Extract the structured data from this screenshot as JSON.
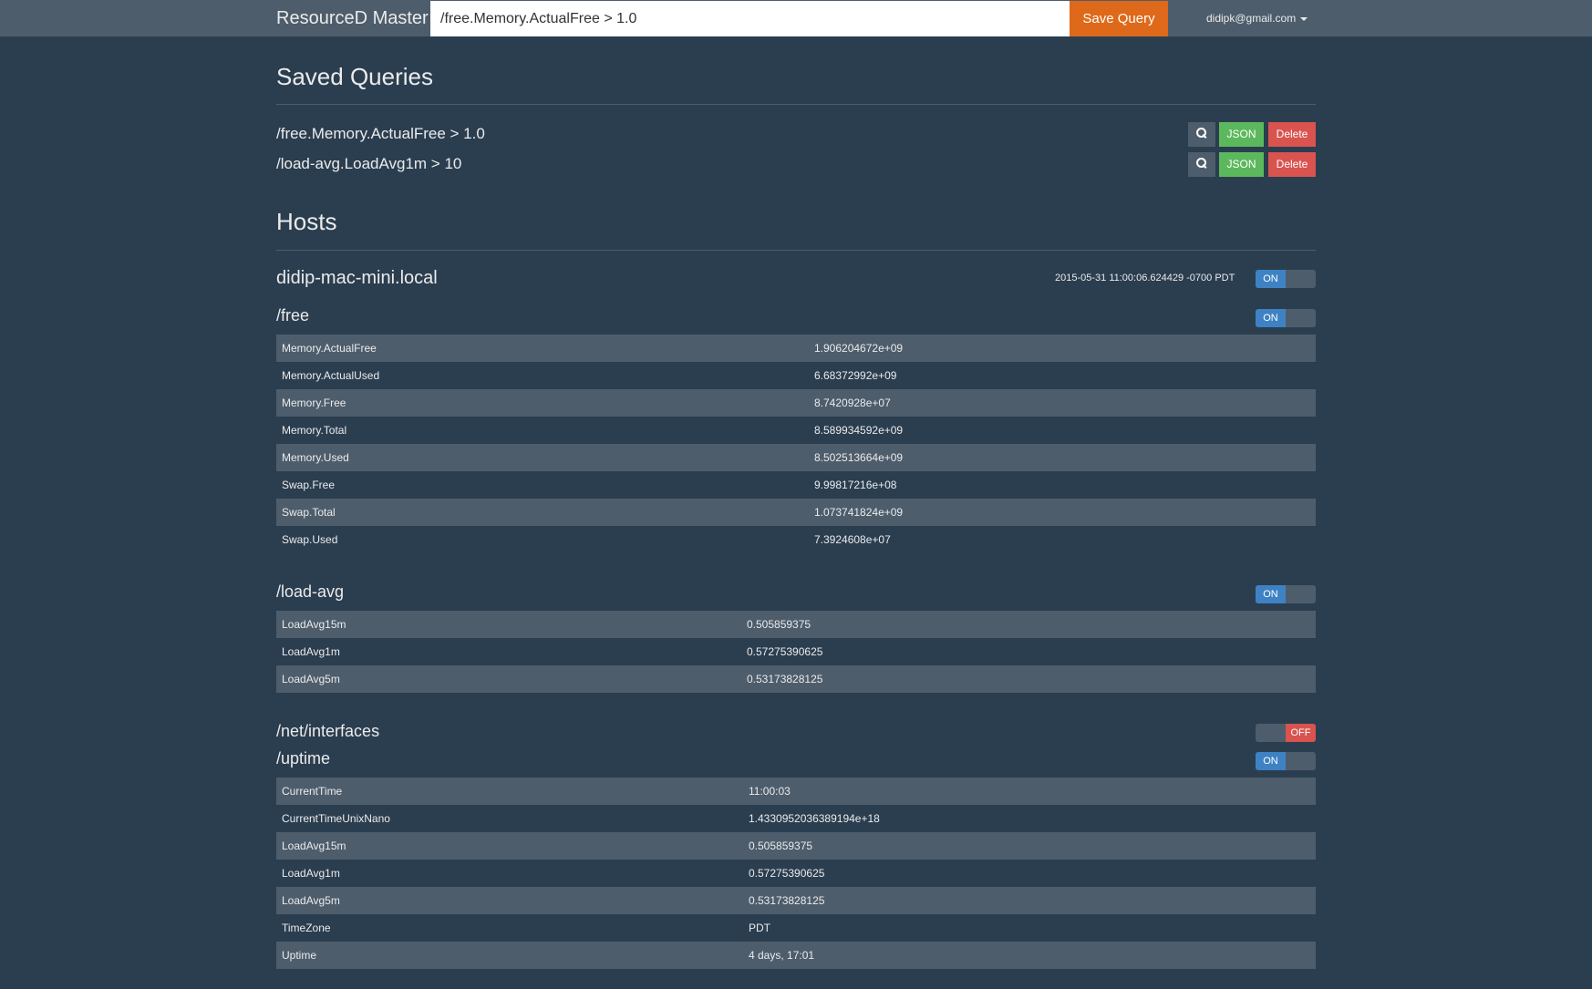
{
  "navbar": {
    "brand": "ResourceD Master",
    "query_value": "/free.Memory.ActualFree > 1.0",
    "save_label": "Save Query",
    "user": "didipk@gmail.com"
  },
  "saved_queries": {
    "title": "Saved Queries",
    "items": [
      {
        "query": "/free.Memory.ActualFree > 1.0",
        "json_label": "JSON",
        "delete_label": "Delete"
      },
      {
        "query": "/load-avg.LoadAvg1m > 10",
        "json_label": "JSON",
        "delete_label": "Delete"
      }
    ]
  },
  "hosts": {
    "title": "Hosts",
    "host": {
      "name": "didip-mac-mini.local",
      "timestamp": "2015-05-31 11:00:06.624429 -0700 PDT",
      "toggle": "ON"
    },
    "readers": {
      "free": {
        "path": "/free",
        "toggle": "ON",
        "rows": [
          [
            "Memory.ActualFree",
            "1.906204672e+09"
          ],
          [
            "Memory.ActualUsed",
            "6.68372992e+09"
          ],
          [
            "Memory.Free",
            "8.7420928e+07"
          ],
          [
            "Memory.Total",
            "8.589934592e+09"
          ],
          [
            "Memory.Used",
            "8.502513664e+09"
          ],
          [
            "Swap.Free",
            "9.99817216e+08"
          ],
          [
            "Swap.Total",
            "1.073741824e+09"
          ],
          [
            "Swap.Used",
            "7.3924608e+07"
          ]
        ]
      },
      "load_avg": {
        "path": "/load-avg",
        "toggle": "ON",
        "rows": [
          [
            "LoadAvg15m",
            "0.505859375"
          ],
          [
            "LoadAvg1m",
            "0.57275390625"
          ],
          [
            "LoadAvg5m",
            "0.53173828125"
          ]
        ]
      },
      "net_interfaces": {
        "path": "/net/interfaces",
        "toggle": "OFF"
      },
      "uptime": {
        "path": "/uptime",
        "toggle": "ON",
        "rows": [
          [
            "CurrentTime",
            "11:00:03"
          ],
          [
            "CurrentTimeUnixNano",
            "1.4330952036389194e+18"
          ],
          [
            "LoadAvg15m",
            "0.505859375"
          ],
          [
            "LoadAvg1m",
            "0.57275390625"
          ],
          [
            "LoadAvg5m",
            "0.53173828125"
          ],
          [
            "TimeZone",
            "PDT"
          ],
          [
            "Uptime",
            "4 days, 17:01"
          ]
        ]
      }
    }
  }
}
